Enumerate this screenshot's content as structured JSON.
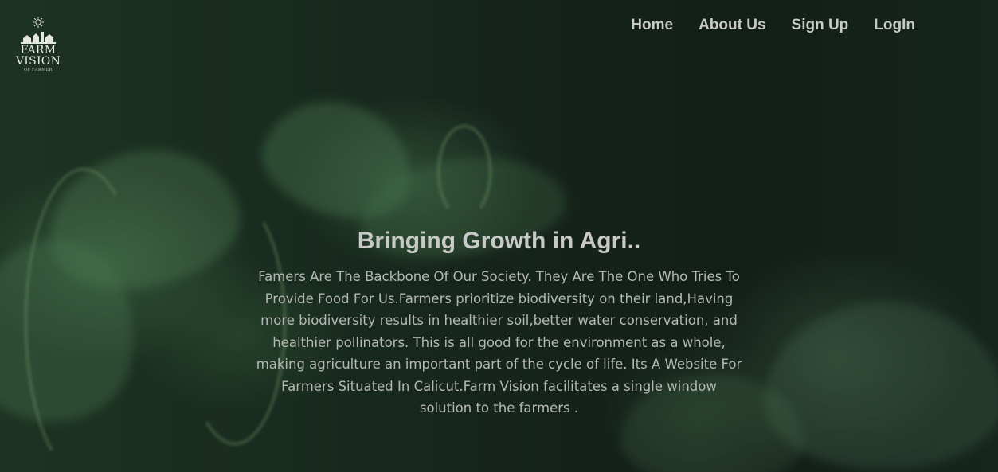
{
  "logo": {
    "icon": "farm-sun-emblem-icon",
    "title_line1": "FARM",
    "title_line2": "VISION",
    "subtitle": "OF FARMER"
  },
  "nav": {
    "items": [
      {
        "label": "Home"
      },
      {
        "label": "About Us"
      },
      {
        "label": "Sign Up"
      },
      {
        "label": "LogIn"
      }
    ]
  },
  "hero": {
    "headline": "Bringing Growth in Agri..",
    "description": "Famers Are The Backbone Of Our Society. They Are The One Who Tries To Provide Food For Us.Farmers prioritize biodiversity on their land,Having more biodiversity results in healthier soil,better water conservation, and healthier pollinators. This is all good for the environment as a whole, making agriculture an important part of the cycle of life. Its A Website For Farmers Situated In Calicut.Farm Vision facilitates a single window solution to the farmers ."
  },
  "colors": {
    "nav_text": "#c7c9c6",
    "headline_text": "#c9cac8",
    "body_text": "#b5b8b4",
    "background_dark": "#15201a",
    "leaf_green": "#6eaa6e"
  }
}
